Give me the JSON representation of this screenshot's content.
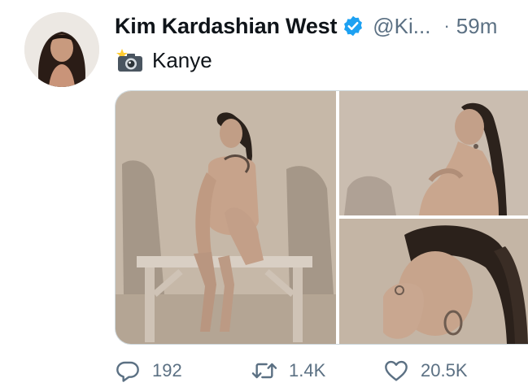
{
  "tweet": {
    "author_name": "Kim Kardashian West",
    "handle": "@Ki...",
    "separator": "·",
    "time": "59m",
    "text": "Kanye",
    "verified": true
  },
  "media": {
    "photos": [
      "photo-seated-on-bench",
      "photo-profile-braid",
      "photo-closeup-hand"
    ]
  },
  "actions": {
    "reply_count": "192",
    "retweet_count": "1.4K",
    "like_count": "20.5K"
  },
  "colors": {
    "verified_blue": "#1da1f2",
    "secondary_text": "#5b7083",
    "primary_text": "#0f1419"
  }
}
